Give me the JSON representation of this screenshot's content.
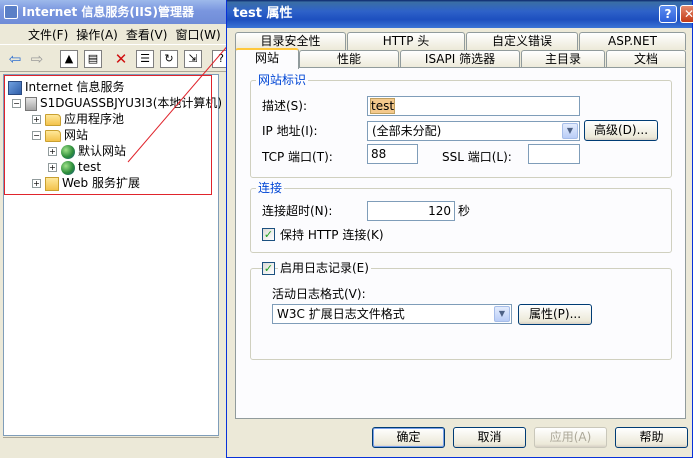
{
  "iis": {
    "title": "Internet 信息服务(IIS)管理器",
    "menu": [
      "文件(F)",
      "操作(A)",
      "查看(V)",
      "窗口(W)"
    ],
    "tree": {
      "root": "Internet 信息服务",
      "server": "S1DGUASSBJYU3I3(本地计算机)",
      "app_pools": "应用程序池",
      "websites": "网站",
      "default_site": "默认网站",
      "test_site": "test",
      "web_ext": "Web 服务扩展"
    }
  },
  "dialog": {
    "title": "test 属性",
    "tabs_back": [
      "目录安全性",
      "HTTP 头",
      "自定义错误",
      "ASP.NET"
    ],
    "tabs_front": [
      "网站",
      "性能",
      "ISAPI 筛选器",
      "主目录",
      "文档"
    ],
    "identity": {
      "group_label": "网站标识",
      "desc_label": "描述(S):",
      "desc_value": "test",
      "ip_label": "IP 地址(I):",
      "ip_value": "(全部未分配)",
      "advanced_btn": "高级(D)...",
      "tcp_label": "TCP 端口(T):",
      "tcp_value": "88",
      "ssl_label": "SSL 端口(L):",
      "ssl_value": ""
    },
    "connection": {
      "group_label": "连接",
      "timeout_label": "连接超时(N):",
      "timeout_value": "120",
      "timeout_unit": "秒",
      "keepalive_label": "保持 HTTP 连接(K)"
    },
    "logging": {
      "enable_label": "启用日志记录(E)",
      "format_label": "活动日志格式(V):",
      "format_value": "W3C 扩展日志文件格式",
      "props_btn": "属性(P)..."
    },
    "buttons": {
      "ok": "确定",
      "cancel": "取消",
      "apply": "应用(A)",
      "help": "帮助"
    }
  }
}
